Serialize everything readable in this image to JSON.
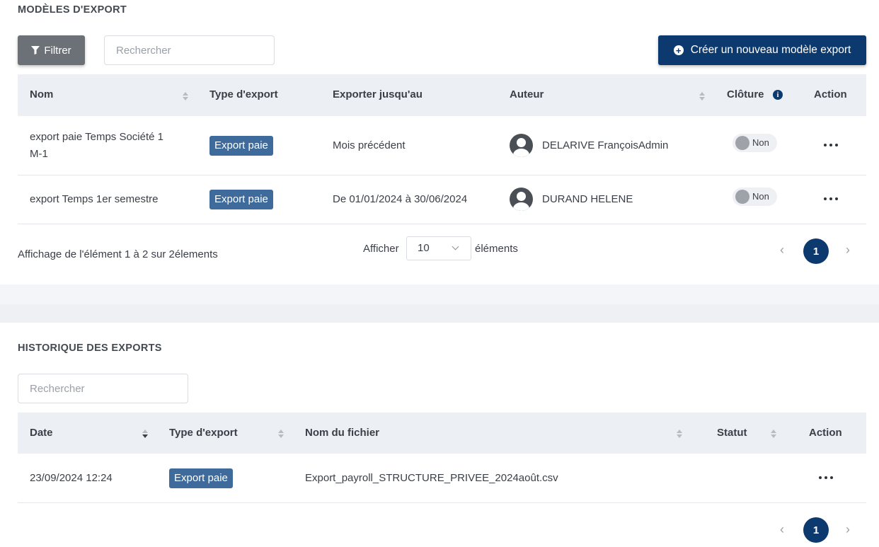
{
  "templates": {
    "title": "MODÈLES D'EXPORT",
    "filter_label": "Filtrer",
    "search_placeholder": "Rechercher",
    "create_label": "Créer un nouveau modèle export",
    "columns": {
      "name": "Nom",
      "type": "Type d'export",
      "until": "Exporter jusqu'au",
      "author": "Auteur",
      "closure": "Clôture",
      "action": "Action"
    },
    "rows": [
      {
        "name_line1": "export paie Temps Société 1",
        "name_line2": "M-1",
        "type": "Export paie",
        "until": "Mois précédent",
        "author": "DELARIVE FrançoisAdmin",
        "closure": "Non"
      },
      {
        "name_line1": "export Temps 1er semestre",
        "name_line2": "",
        "type": "Export paie",
        "until": "De 01/01/2024 à 30/06/2024",
        "author": "DURAND HELENE",
        "closure": "Non"
      }
    ],
    "pagination": {
      "summary": "Affichage de l'élément 1 à 2 sur 2élements",
      "show_label": "Afficher",
      "page_size": "10",
      "items_label": "éléments",
      "current_page": "1",
      "prev": "‹",
      "next": "›"
    }
  },
  "history": {
    "title": "HISTORIQUE DES EXPORTS",
    "search_placeholder": "Rechercher",
    "columns": {
      "date": "Date",
      "type": "Type d'export",
      "filename": "Nom du fichier",
      "status": "Statut",
      "action": "Action"
    },
    "rows": [
      {
        "date": "23/09/2024 12:24",
        "type": "Export paie",
        "filename": "Export_payroll_STRUCTURE_PRIVEE_2024août.csv",
        "status": ""
      }
    ],
    "pagination": {
      "current_page": "1",
      "prev": "‹",
      "next": "›"
    }
  },
  "colors": {
    "primary": "#0d3a6e",
    "badge": "#3e6b9b",
    "filter_button": "#6c7177",
    "table_header": "#eceff4"
  }
}
